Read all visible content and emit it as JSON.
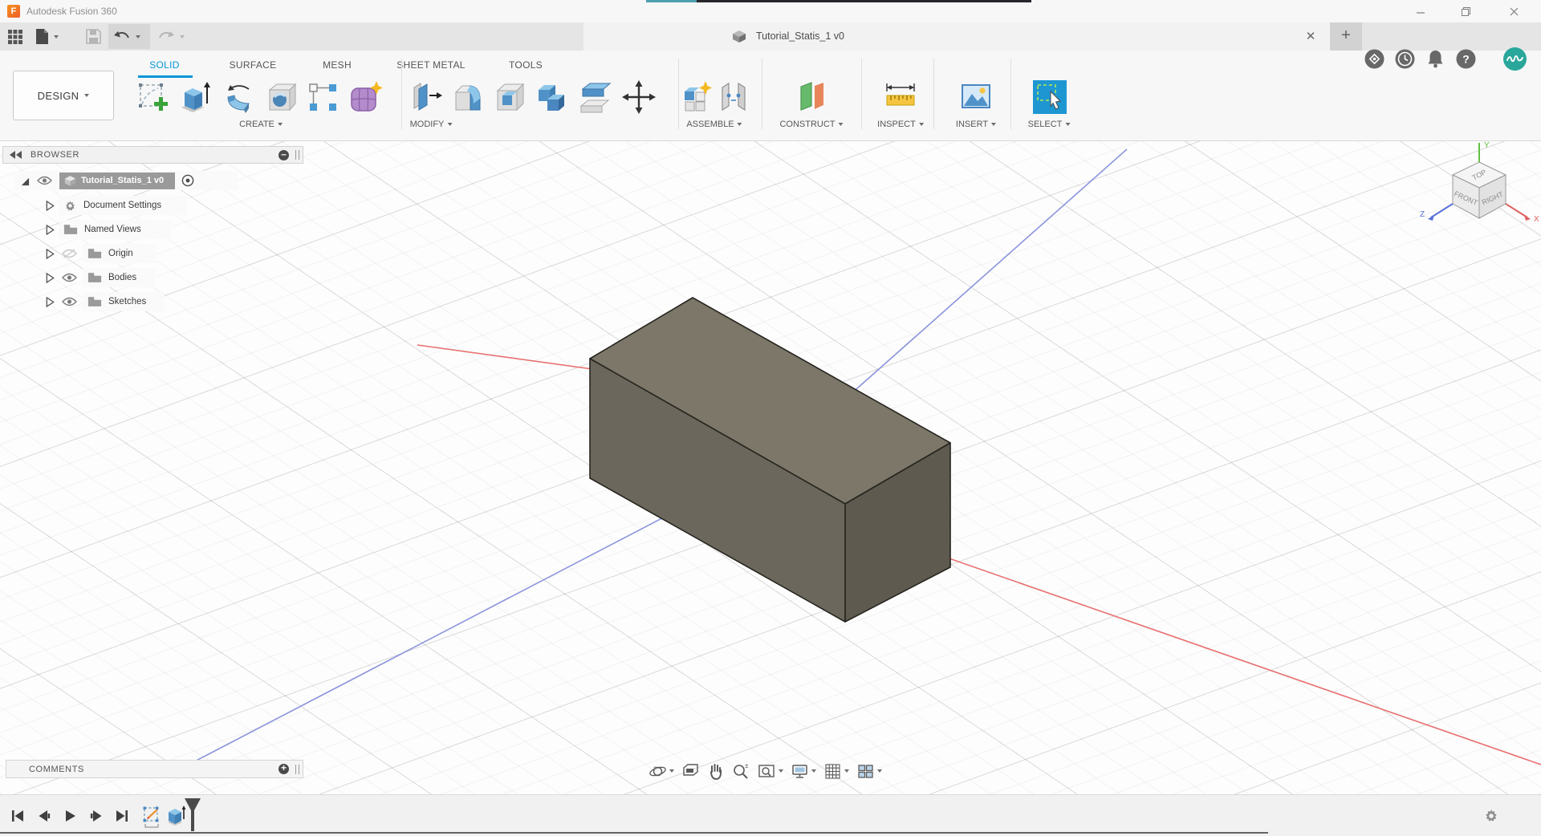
{
  "os_window": {
    "app_title": "Autodesk Fusion 360"
  },
  "document_tab": {
    "title": "Tutorial_Statis_1 v0"
  },
  "ribbon": {
    "workspace_label": "DESIGN",
    "tabs": [
      {
        "label": "SOLID",
        "active": true
      },
      {
        "label": "SURFACE",
        "active": false
      },
      {
        "label": "MESH",
        "active": false
      },
      {
        "label": "SHEET METAL",
        "active": false
      },
      {
        "label": "TOOLS",
        "active": false
      }
    ],
    "groups": [
      {
        "label": "CREATE"
      },
      {
        "label": "MODIFY"
      },
      {
        "label": "ASSEMBLE"
      },
      {
        "label": "CONSTRUCT"
      },
      {
        "label": "INSPECT"
      },
      {
        "label": "INSERT"
      },
      {
        "label": "SELECT"
      }
    ]
  },
  "browser": {
    "title": "BROWSER",
    "root_label": "Tutorial_Statis_1 v0",
    "items": [
      {
        "label": "Document Settings"
      },
      {
        "label": "Named Views"
      },
      {
        "label": "Origin"
      },
      {
        "label": "Bodies"
      },
      {
        "label": "Sketches"
      }
    ]
  },
  "viewcube": {
    "top": "TOP",
    "front": "FRONT",
    "right": "RIGHT",
    "axis_x": "X",
    "axis_y": "Y",
    "axis_z": "Z"
  },
  "comments_panel": {
    "title": "COMMENTS"
  },
  "icons": {
    "toolbar": [
      "apps-grid",
      "file-new",
      "save",
      "undo",
      "redo"
    ],
    "header_right": [
      "close-tab",
      "new-tab",
      "extensions",
      "job-status",
      "notifications",
      "help",
      "avatar"
    ],
    "nav_bar": [
      "orbit",
      "look-at",
      "pan",
      "zoom",
      "fit",
      "display-settings",
      "grid",
      "viewports"
    ],
    "timeline": [
      "skip-to-start",
      "step-back",
      "play",
      "step-forward",
      "skip-to-end",
      "sketch-feature",
      "extrude-feature"
    ]
  },
  "colors": {
    "accent_blue": "#0696d7",
    "select_blue": "#1e96d2",
    "axis_red": "#e87070",
    "axis_blue": "#8b94dc",
    "avatar_teal": "#2aa79b",
    "body_top": "#7c7769",
    "body_left": "#6c675c",
    "body_right": "#5e5a50"
  }
}
